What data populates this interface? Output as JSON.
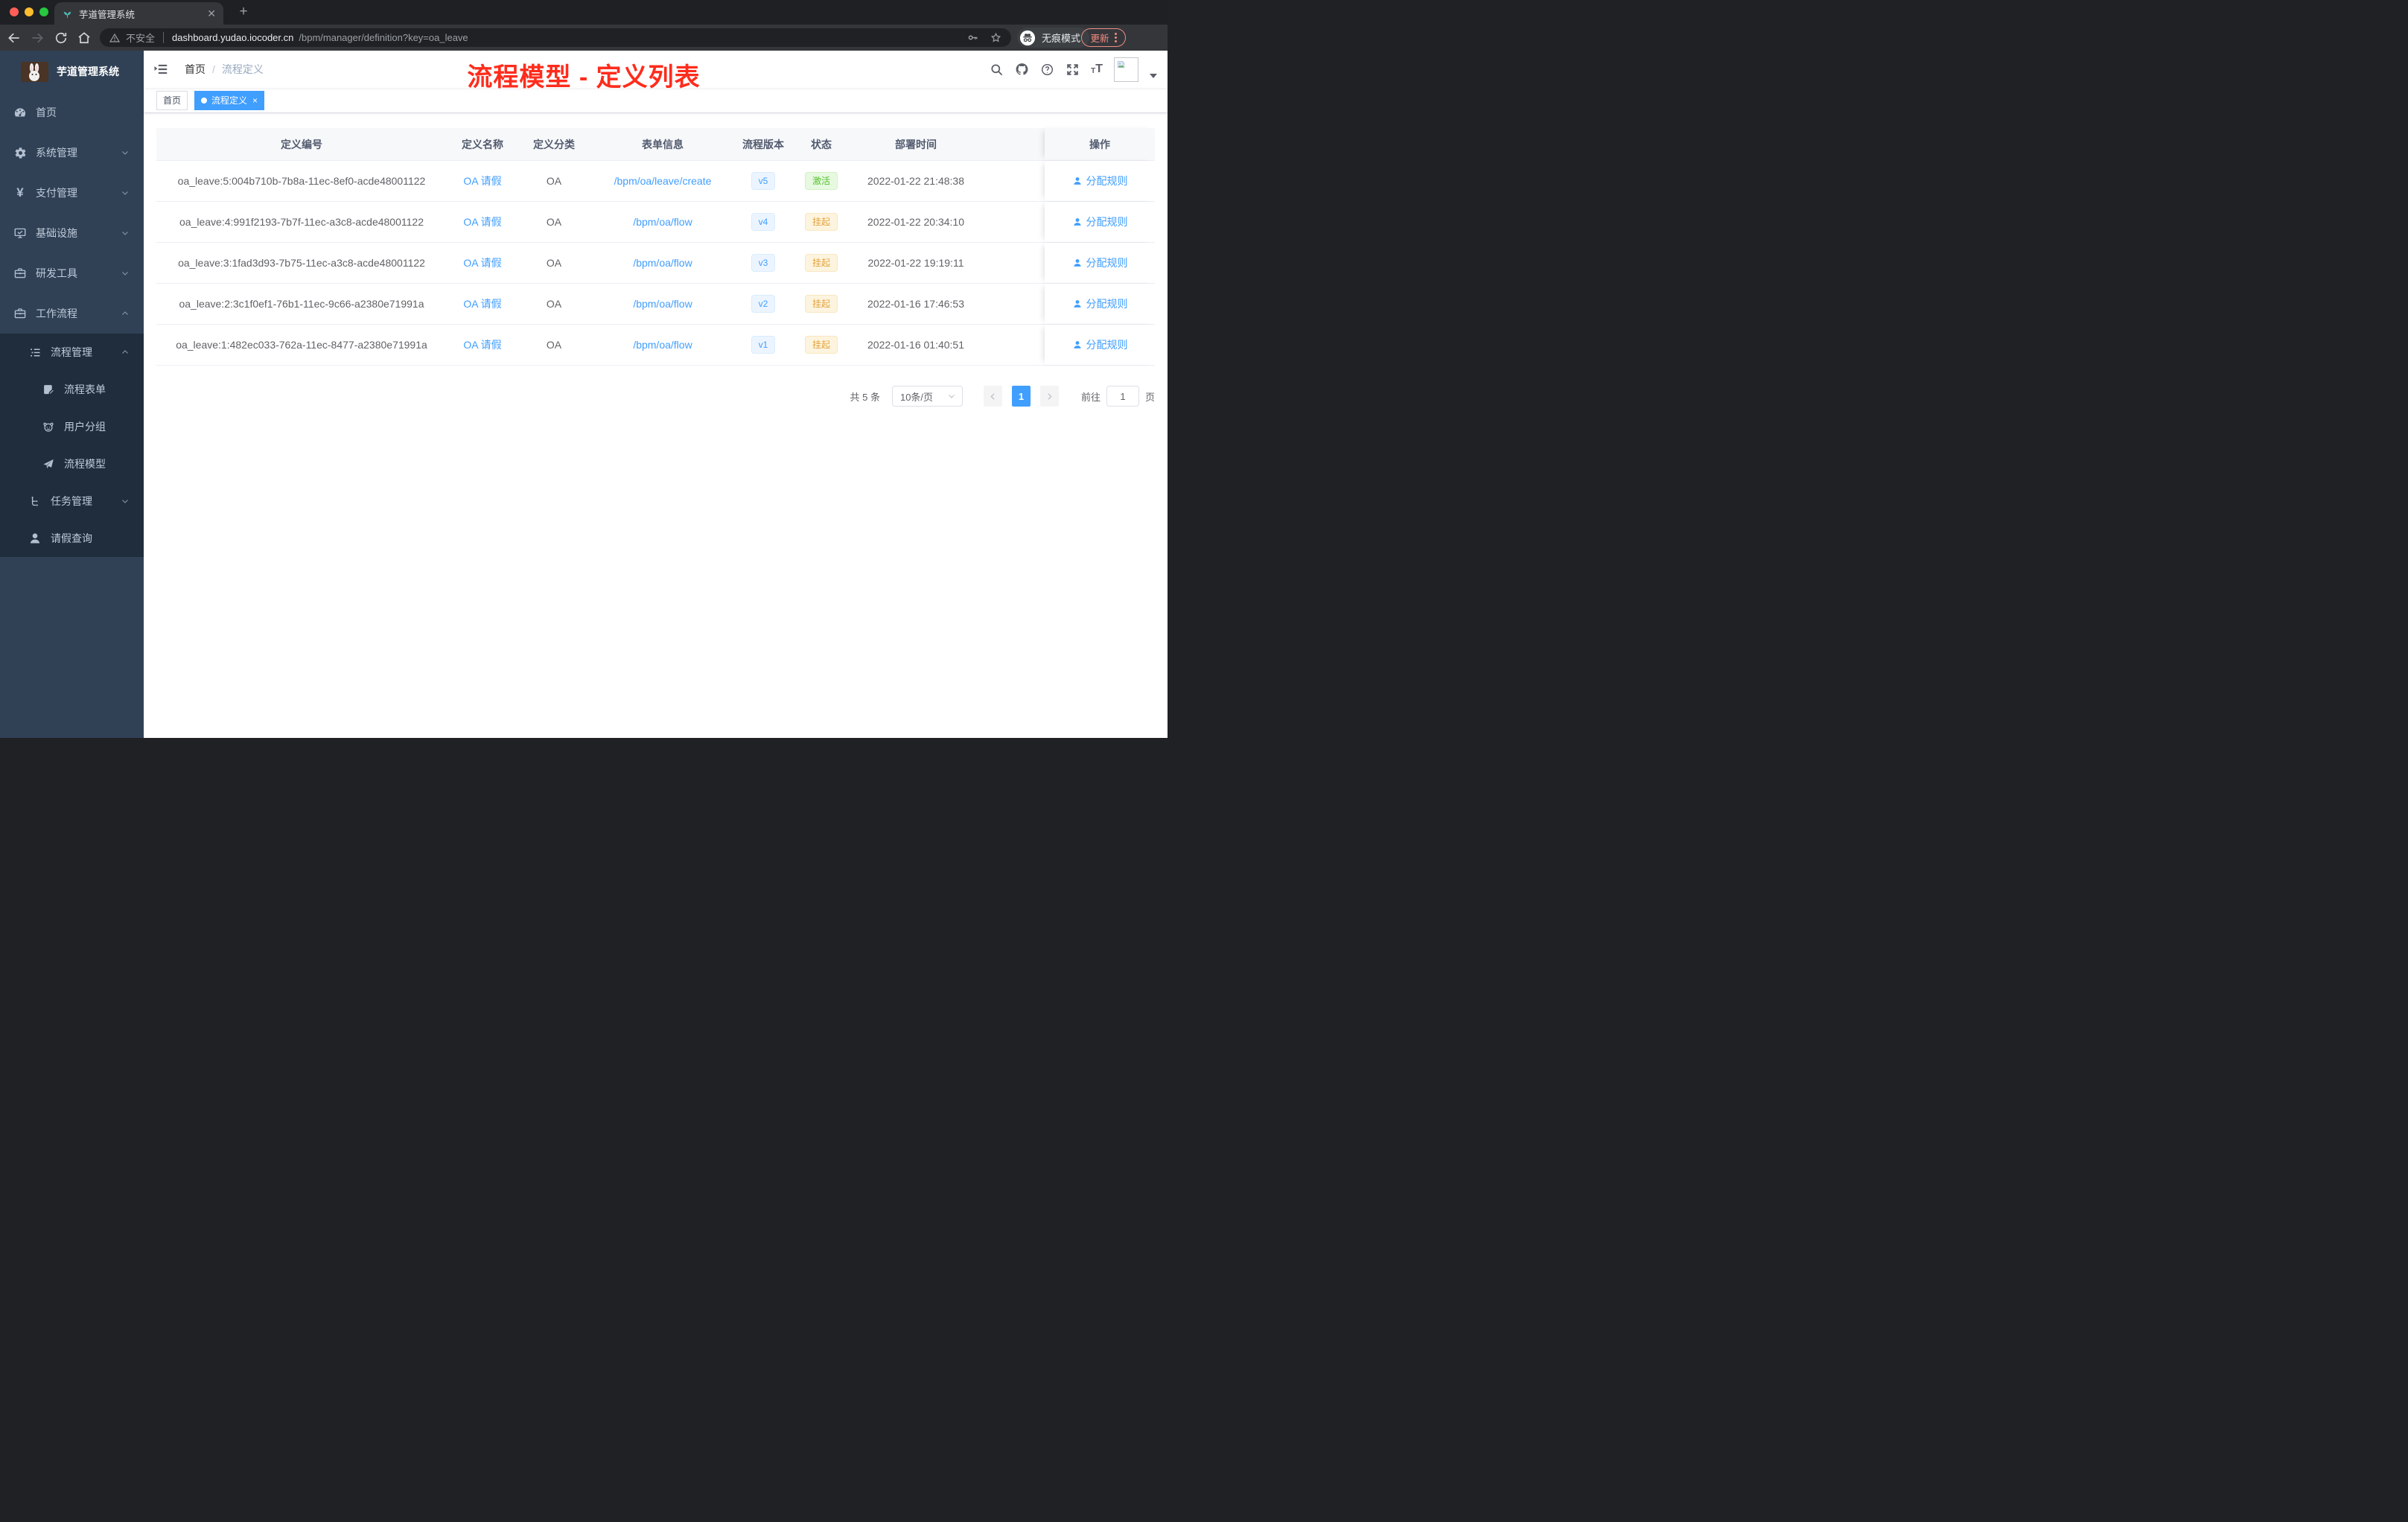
{
  "browser": {
    "tab_title": "芋道管理系统",
    "security_label": "不安全",
    "url_host": "dashboard.yudao.iocoder.cn",
    "url_path": "/bpm/manager/definition?key=oa_leave",
    "incognito_label": "无痕模式",
    "update_label": "更新"
  },
  "sidebar": {
    "logo_title": "芋道管理系统",
    "menu": [
      {
        "key": "home",
        "label": "首页",
        "icon": "dashboard-icon",
        "level": 1,
        "arrow": ""
      },
      {
        "key": "system-management",
        "label": "系统管理",
        "icon": "gear-icon",
        "level": 1,
        "arrow": "down"
      },
      {
        "key": "payment-management",
        "label": "支付管理",
        "icon": "yen-icon",
        "level": 1,
        "arrow": "down"
      },
      {
        "key": "infrastructure",
        "label": "基础设施",
        "icon": "monitor-icon",
        "level": 1,
        "arrow": "down"
      },
      {
        "key": "dev-tools",
        "label": "研发工具",
        "icon": "briefcase-icon",
        "level": 1,
        "arrow": "down"
      },
      {
        "key": "workflow",
        "label": "工作流程",
        "icon": "briefcase-icon",
        "level": 1,
        "arrow": "up"
      },
      {
        "key": "process-management",
        "label": "流程管理",
        "icon": "tree-list-icon",
        "level": 2,
        "arrow": "up"
      },
      {
        "key": "process-form",
        "label": "流程表单",
        "icon": "form-edit-icon",
        "level": 3,
        "arrow": ""
      },
      {
        "key": "user-group",
        "label": "用户分组",
        "icon": "robot-icon",
        "level": 3,
        "arrow": ""
      },
      {
        "key": "process-model",
        "label": "流程模型",
        "icon": "paper-plane-icon",
        "level": 3,
        "arrow": ""
      },
      {
        "key": "task-management",
        "label": "任务管理",
        "icon": "flow-tree-icon",
        "level": 2,
        "arrow": "down"
      },
      {
        "key": "leave-query",
        "label": "请假查询",
        "icon": "user-icon",
        "level": 2,
        "arrow": ""
      }
    ]
  },
  "header": {
    "breadcrumb": [
      "首页",
      "流程定义"
    ],
    "annotation_title": "流程模型 - 定义列表",
    "annotation_color": "#fe2c1c"
  },
  "tags": {
    "home_label": "首页",
    "active_label": "流程定义",
    "close_glyph": "×"
  },
  "table": {
    "columns": [
      "定义编号",
      "定义名称",
      "定义分类",
      "表单信息",
      "流程版本",
      "状态",
      "部署时间",
      "操作"
    ],
    "rows": [
      {
        "id": "oa_leave:5:004b710b-7b8a-11ec-8ef0-acde48001122",
        "name": "OA 请假",
        "category": "OA",
        "form": "/bpm/oa/leave/create",
        "version": "v5",
        "status": "激活",
        "status_type": "success",
        "deploy_time": "2022-01-22 21:48:38",
        "action": "分配规则"
      },
      {
        "id": "oa_leave:4:991f2193-7b7f-11ec-a3c8-acde48001122",
        "name": "OA 请假",
        "category": "OA",
        "form": "/bpm/oa/flow",
        "version": "v4",
        "status": "挂起",
        "status_type": "warning",
        "deploy_time": "2022-01-22 20:34:10",
        "action": "分配规则"
      },
      {
        "id": "oa_leave:3:1fad3d93-7b75-11ec-a3c8-acde48001122",
        "name": "OA 请假",
        "category": "OA",
        "form": "/bpm/oa/flow",
        "version": "v3",
        "status": "挂起",
        "status_type": "warning",
        "deploy_time": "2022-01-22 19:19:11",
        "action": "分配规则"
      },
      {
        "id": "oa_leave:2:3c1f0ef1-76b1-11ec-9c66-a2380e71991a",
        "name": "OA 请假",
        "category": "OA",
        "form": "/bpm/oa/flow",
        "version": "v2",
        "status": "挂起",
        "status_type": "warning",
        "deploy_time": "2022-01-16 17:46:53",
        "action": "分配规则"
      },
      {
        "id": "oa_leave:1:482ec033-762a-11ec-8477-a2380e71991a",
        "name": "OA 请假",
        "category": "OA",
        "form": "/bpm/oa/flow",
        "version": "v1",
        "status": "挂起",
        "status_type": "warning",
        "deploy_time": "2022-01-16 01:40:51",
        "action": "分配规则"
      }
    ]
  },
  "pagination": {
    "total_label": "共 5 条",
    "page_size": "10条/页",
    "current_page": "1",
    "goto_label": "前往",
    "goto_value": "1",
    "page_unit": "页"
  },
  "colors": {
    "accent": "#409eff",
    "success": "#67c23a",
    "warning": "#e6a23c",
    "sidebar_bg": "#304156",
    "sidebar_sub_bg": "#1f2d3d",
    "annotation": "#fe2c1c"
  }
}
